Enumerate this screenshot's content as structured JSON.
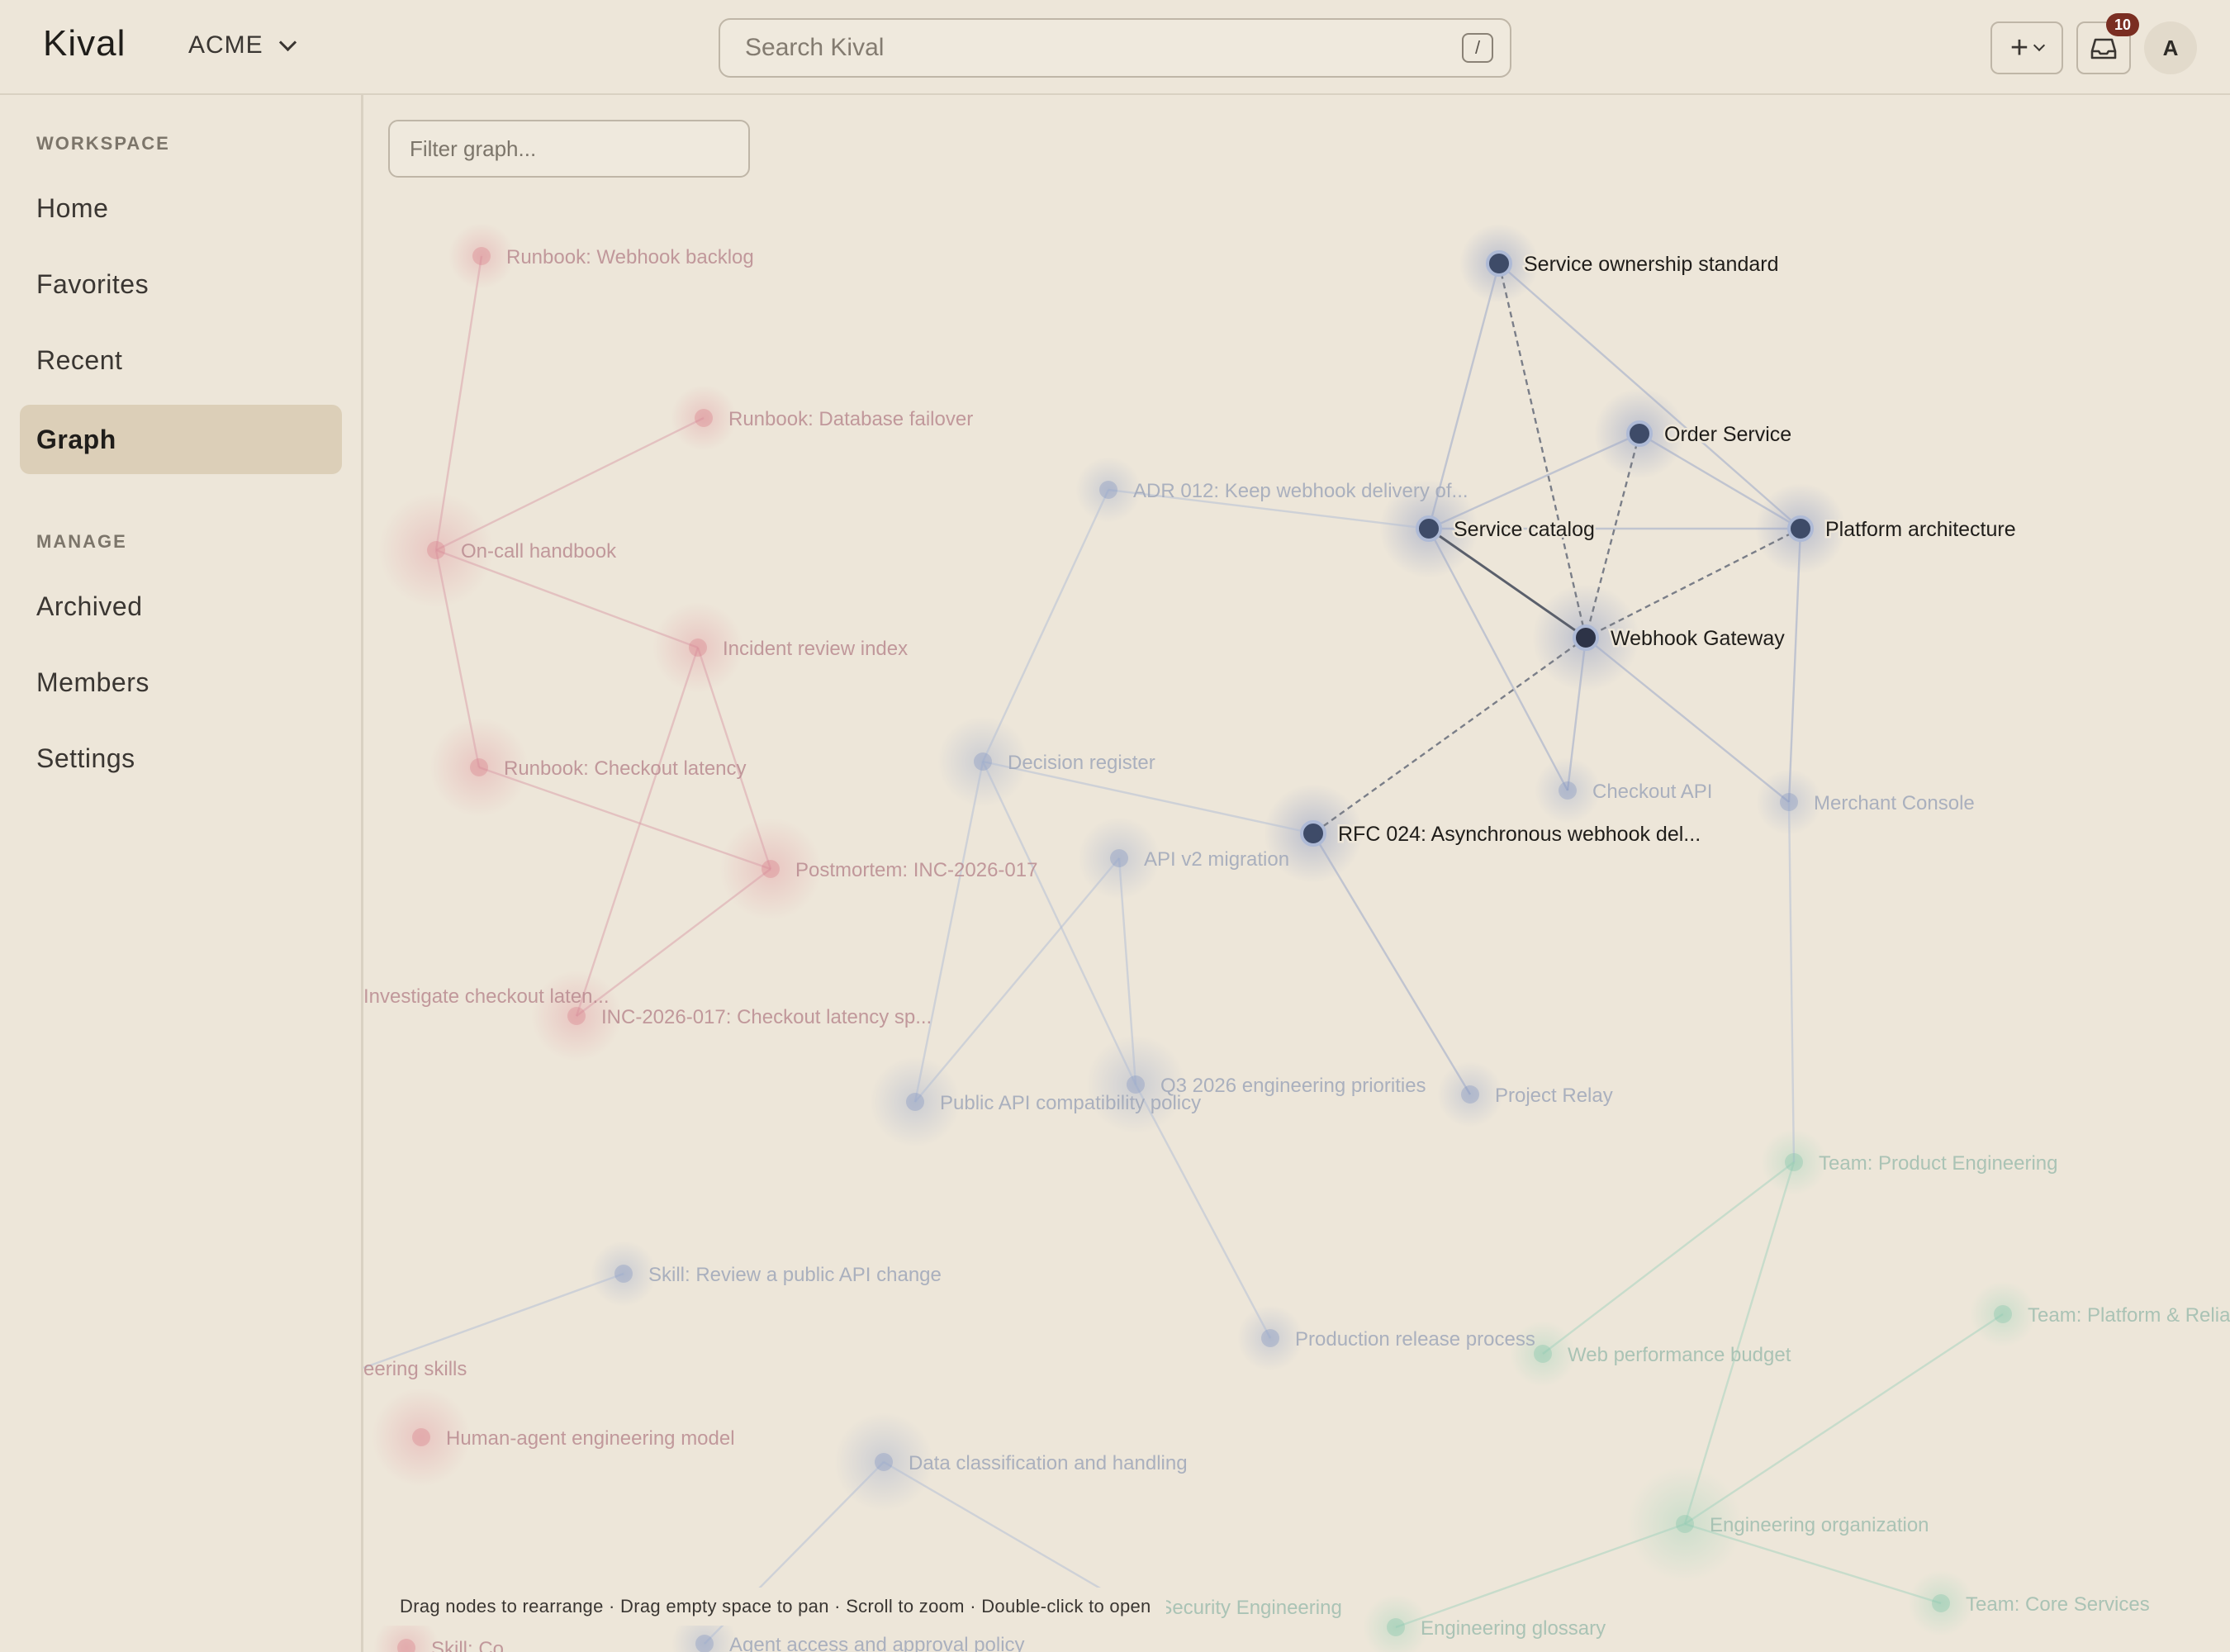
{
  "app": {
    "logo": "Kival",
    "workspace": "ACME"
  },
  "search": {
    "placeholder": "Search Kival",
    "shortcut": "/"
  },
  "header": {
    "notifications_count": "10",
    "avatar_initial": "A"
  },
  "sidebar": {
    "workspace_label": "WORKSPACE",
    "workspace_items": [
      "Home",
      "Favorites",
      "Recent",
      "Graph"
    ],
    "active_item": "Graph",
    "manage_label": "MANAGE",
    "manage_items": [
      "Archived",
      "Members",
      "Settings"
    ]
  },
  "graph": {
    "filter_placeholder": "Filter graph...",
    "hint": "Drag nodes to rearrange · Drag empty space to pan · Scroll to zoom · Double-click to open",
    "colors": {
      "focus_node": "#3e4b68",
      "focus_core": "#2d3347",
      "blue_node": "#7f93bf",
      "pink_node": "#d97a86",
      "green_node": "#7fc4a6",
      "edge_solid": "#5a5f6b",
      "edge_dashed": "#7a7e88"
    },
    "nodes": [
      {
        "id": "service-ownership-standard",
        "label": "Service ownership standard",
        "group": "focus"
      },
      {
        "id": "order-service",
        "label": "Order Service",
        "group": "focus"
      },
      {
        "id": "service-catalog",
        "label": "Service catalog",
        "group": "focus"
      },
      {
        "id": "platform-architecture",
        "label": "Platform architecture",
        "group": "focus"
      },
      {
        "id": "webhook-gateway",
        "label": "Webhook Gateway",
        "group": "focus-core"
      },
      {
        "id": "rfc-024",
        "label": "RFC 024: Asynchronous webhook del...",
        "group": "focus"
      },
      {
        "id": "runbook-webhook-backlog",
        "label": "Runbook: Webhook backlog",
        "group": "pink"
      },
      {
        "id": "runbook-database-failover",
        "label": "Runbook: Database failover",
        "group": "pink"
      },
      {
        "id": "on-call-handbook",
        "label": "On-call handbook",
        "group": "pink"
      },
      {
        "id": "incident-review-index",
        "label": "Incident review index",
        "group": "pink"
      },
      {
        "id": "runbook-checkout-latency",
        "label": "Runbook: Checkout latency",
        "group": "pink"
      },
      {
        "id": "postmortem-inc-2026-017",
        "label": "Postmortem: INC-2026-017",
        "group": "pink"
      },
      {
        "id": "inc-2026-017",
        "label": "INC-2026-017: Checkout latency sp...",
        "group": "pink"
      },
      {
        "id": "investigate-checkout",
        "label": "Investigate checkout laten...",
        "group": "pink-label"
      },
      {
        "id": "adr-012",
        "label": "ADR 012: Keep webhook delivery of...",
        "group": "blue"
      },
      {
        "id": "decision-register",
        "label": "Decision register",
        "group": "blue"
      },
      {
        "id": "api-v2-migration",
        "label": "API v2 migration",
        "group": "blue"
      },
      {
        "id": "checkout-api",
        "label": "Checkout API",
        "group": "blue"
      },
      {
        "id": "merchant-console",
        "label": "Merchant Console",
        "group": "blue"
      },
      {
        "id": "public-api-compat",
        "label": "Public API compatibility policy",
        "group": "blue"
      },
      {
        "id": "q3-priorities",
        "label": "Q3 2026 engineering priorities",
        "group": "blue"
      },
      {
        "id": "project-relay",
        "label": "Project Relay",
        "group": "blue"
      },
      {
        "id": "skill-review-api",
        "label": "Skill: Review a public API change",
        "group": "blue"
      },
      {
        "id": "production-release",
        "label": "Production release process",
        "group": "blue"
      },
      {
        "id": "data-classification",
        "label": "Data classification and handling",
        "group": "blue"
      },
      {
        "id": "agent-access",
        "label": "Agent access and approval policy",
        "group": "blue"
      },
      {
        "id": "team-product-eng",
        "label": "Team: Product Engineering",
        "group": "green"
      },
      {
        "id": "team-platform",
        "label": "Team: Platform & Relia",
        "group": "green"
      },
      {
        "id": "web-perf-budget",
        "label": "Web performance budget",
        "group": "green"
      },
      {
        "id": "engineering-org",
        "label": "Engineering organization",
        "group": "green"
      },
      {
        "id": "team-core-services",
        "label": "Team: Core Services",
        "group": "green"
      },
      {
        "id": "engineering-glossary",
        "label": "Engineering glossary",
        "group": "green"
      },
      {
        "id": "team-security-eng",
        "label": "m: Security Engineering",
        "group": "green-label"
      },
      {
        "id": "engineering-skills",
        "label": "eering skills",
        "group": "pink-label"
      },
      {
        "id": "human-agent-model",
        "label": "Human-agent engineering model",
        "group": "pink"
      },
      {
        "id": "skill-bottom",
        "label": "Skill: Co...",
        "group": "pink"
      }
    ]
  }
}
